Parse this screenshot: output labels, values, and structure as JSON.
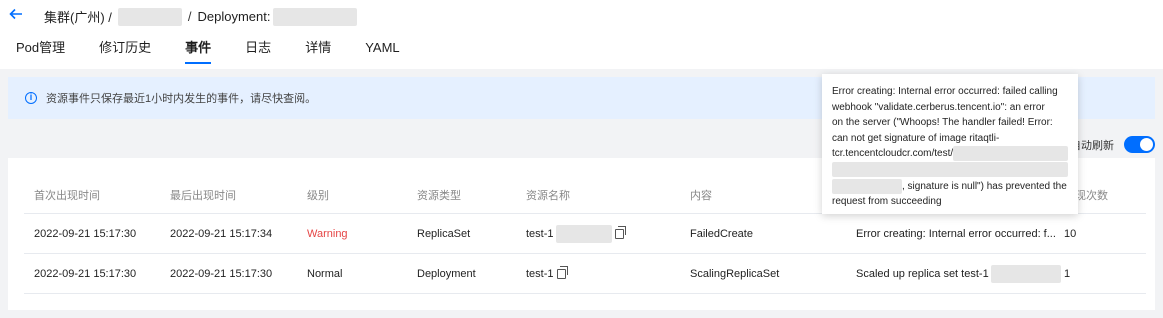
{
  "header": {
    "back_icon": "arrow-left-icon",
    "breadcrumb_cluster": "集群(广州) /",
    "breadcrumb_sep": "/",
    "breadcrumb_type": "Deployment:"
  },
  "tabs": [
    {
      "label": "Pod管理",
      "active": false
    },
    {
      "label": "修订历史",
      "active": false
    },
    {
      "label": "事件",
      "active": true
    },
    {
      "label": "日志",
      "active": false
    },
    {
      "label": "详情",
      "active": false
    },
    {
      "label": "YAML",
      "active": false
    }
  ],
  "notice": {
    "icon": "info-icon",
    "text": "资源事件只保存最近1小时内发生的事件，请尽快查阅。"
  },
  "refresh": {
    "label": "自动刷新",
    "enabled": true
  },
  "table": {
    "columns": [
      "首次出现时间",
      "最后出现时间",
      "级别",
      "资源类型",
      "资源名称",
      "内容",
      "",
      "出现次数"
    ],
    "rows": [
      {
        "first_seen": "2022-09-21 15:17:30",
        "last_seen": "2022-09-21 15:17:34",
        "level": "Warning",
        "resource_type": "ReplicaSet",
        "resource_name": "test-1",
        "reason": "FailedCreate",
        "message": "Error creating: Internal error occurred: f...",
        "count": "10"
      },
      {
        "first_seen": "2022-09-21 15:17:30",
        "last_seen": "2022-09-21 15:17:30",
        "level": "Normal",
        "resource_type": "Deployment",
        "resource_name": "test-1",
        "reason": "ScalingReplicaSet",
        "message": "Scaled up replica set test-1",
        "count": "1"
      }
    ]
  },
  "tooltip": {
    "lines": [
      "Error creating: Internal error occurred: failed calling",
      "webhook \"validate.cerberus.tencent.io\": an error",
      "on the server (\"Whoops! The handler failed! Error:",
      "can not get signature of image ritaqtli-",
      "tcr.tencentcloudcr.com/test/",
      "",
      ", signature is null\") has prevented the",
      "request from succeeding"
    ]
  },
  "colors": {
    "accent": "#006eff",
    "warning": "#e54545",
    "notice_bg": "#e5f0ff",
    "page_bg": "#f2f3f5"
  }
}
